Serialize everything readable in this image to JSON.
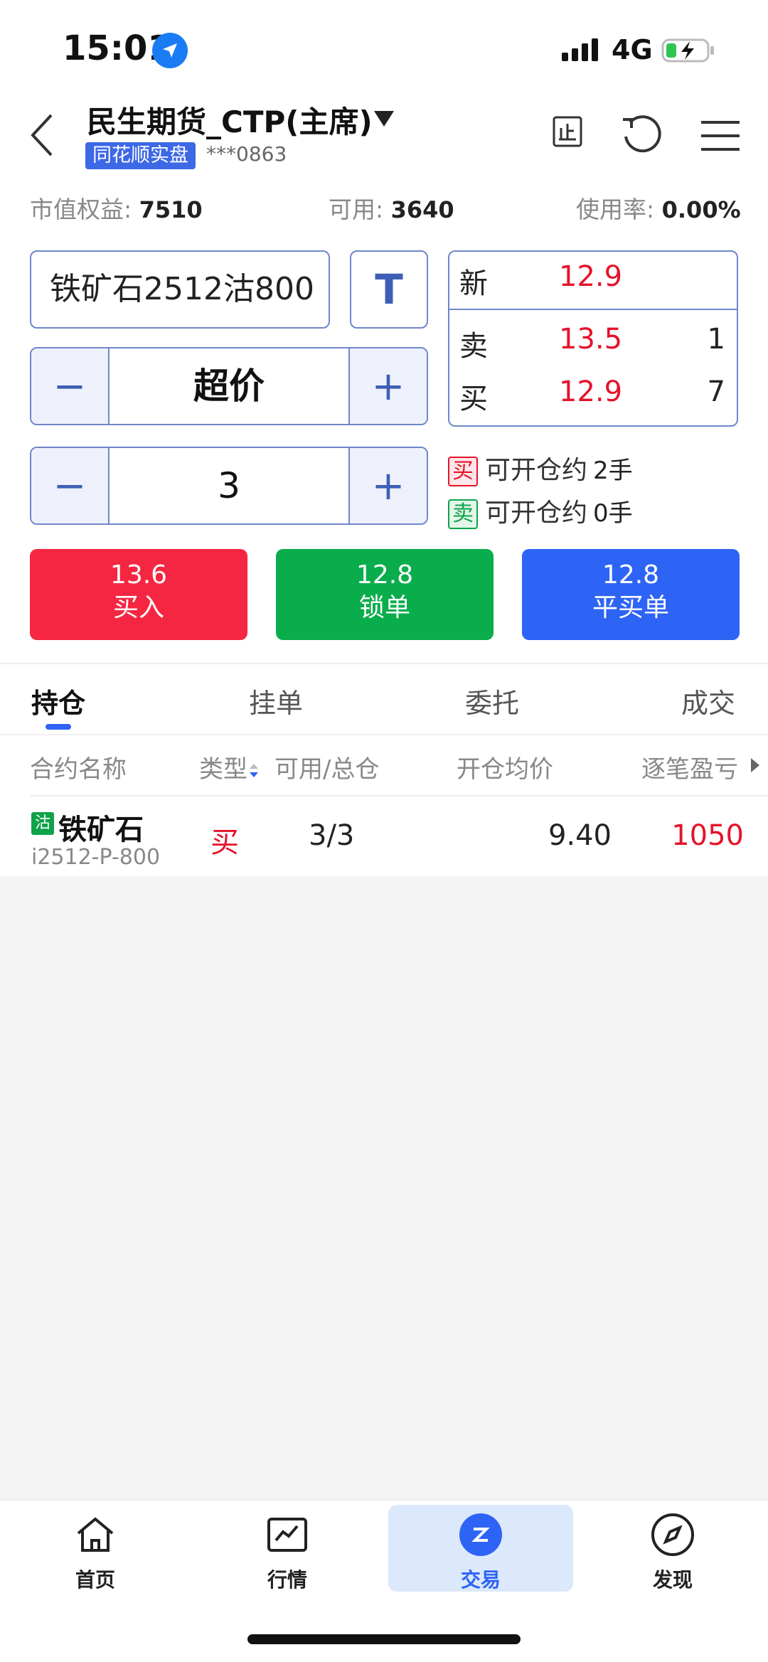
{
  "status_bar": {
    "time": "15:01",
    "network": "4G"
  },
  "header": {
    "title": "民生期货_CTP(主席)",
    "badge": "同花顺实盘",
    "account": "***0863"
  },
  "equity": {
    "market_label": "市值权益:",
    "market_value": "7510",
    "available_label": "可用:",
    "available_value": "3640",
    "usage_label": "使用率:",
    "usage_value": "0.00%"
  },
  "order": {
    "contract": "铁矿石2512沽800",
    "t_label": "T",
    "price_type": "超价",
    "quantity": "3",
    "minus": "−",
    "plus": "+"
  },
  "quote": {
    "last_label": "新",
    "last_price": "12.9",
    "ask_label": "卖",
    "ask_price": "13.5",
    "ask_vol": "1",
    "bid_label": "买",
    "bid_price": "12.9",
    "bid_vol": "7"
  },
  "availability": {
    "buy_tag": "买",
    "buy_text": "可开仓约",
    "buy_num": "2手",
    "sell_tag": "卖",
    "sell_text": "可开仓约",
    "sell_num": "0手"
  },
  "actions": {
    "buy": {
      "price": "13.6",
      "label": "买入"
    },
    "lock": {
      "price": "12.8",
      "label": "锁单"
    },
    "close": {
      "price": "12.8",
      "label": "平买单"
    }
  },
  "tabs": [
    "持仓",
    "挂单",
    "委托",
    "成交"
  ],
  "table": {
    "headers": [
      "合约名称",
      "类型",
      "可用/总仓",
      "开仓均价",
      "逐笔盈亏"
    ],
    "rows": [
      {
        "tag": "沽",
        "name": "铁矿石",
        "code": "i2512-P-800",
        "type": "买",
        "position": "3/3",
        "avg_price": "9.40",
        "pnl": "1050"
      }
    ]
  },
  "nav": [
    "首页",
    "行情",
    "交易",
    "发现"
  ],
  "colors": {
    "accent": "#2e64f5",
    "up": "#e5132a",
    "down": "#0fa24a"
  }
}
